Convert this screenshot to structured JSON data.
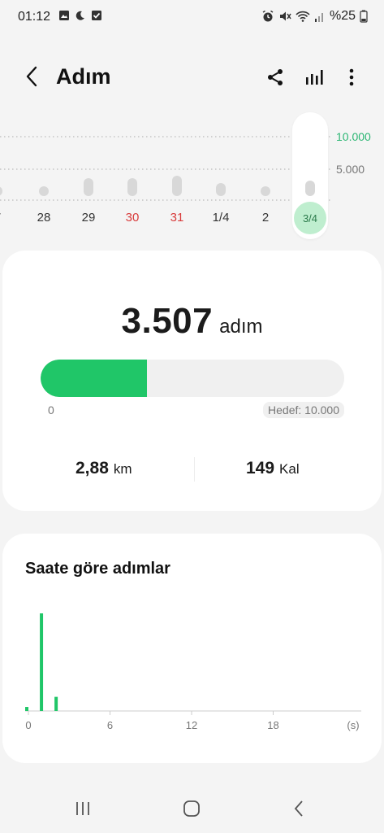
{
  "status_bar": {
    "time": "01:12",
    "left_icons": [
      "image-icon",
      "moon-icon",
      "check-box-icon"
    ],
    "right_icons": [
      "alarm-icon",
      "mute-icon",
      "wifi-icon",
      "signal-icon"
    ],
    "battery": "%25"
  },
  "app_bar": {
    "title": "Adım",
    "back_icon": "back-arrow-icon",
    "actions": [
      "share-icon",
      "chart-icon",
      "more-icon"
    ]
  },
  "week_chart": {
    "goal_label": "10.000",
    "mid_label": "5.000",
    "accent_color": "#2bb673",
    "days": [
      {
        "label": "7",
        "holiday": false,
        "bar_fraction": 0.03
      },
      {
        "label": "28",
        "holiday": false,
        "bar_fraction": 0.04
      },
      {
        "label": "29",
        "holiday": false,
        "bar_fraction": 0.07
      },
      {
        "label": "30",
        "holiday": true,
        "bar_fraction": 0.07
      },
      {
        "label": "31",
        "holiday": true,
        "bar_fraction": 0.08
      },
      {
        "label": "1/4",
        "holiday": false,
        "bar_fraction": 0.05
      },
      {
        "label": "2",
        "holiday": false,
        "bar_fraction": 0.04
      },
      {
        "label": "3/4",
        "holiday": false,
        "bar_fraction": 0.06,
        "selected": true
      }
    ]
  },
  "summary": {
    "steps": "3.507",
    "steps_unit": "adım",
    "progress_fraction": 0.3507,
    "progress_min": "0",
    "goal_text": "Hedef: 10.000",
    "distance_value": "2,88",
    "distance_unit": "km",
    "calories_value": "149",
    "calories_unit": "Kal",
    "accent_color": "#20c668"
  },
  "hourly": {
    "title": "Saate göre adımlar",
    "chart_data": {
      "type": "bar",
      "title": "Saate göre adımlar",
      "x": [
        0,
        0.5,
        1
      ],
      "values": [
        120,
        2900,
        420
      ],
      "xticks": [
        "0",
        "6",
        "12",
        "18",
        "(s)"
      ],
      "xlim": [
        0,
        24
      ],
      "ylabel": "",
      "xlabel": "",
      "grid": false,
      "color": "#20c668"
    }
  },
  "nav_bar": {
    "buttons": [
      "recents-icon",
      "home-icon",
      "back-icon"
    ]
  }
}
